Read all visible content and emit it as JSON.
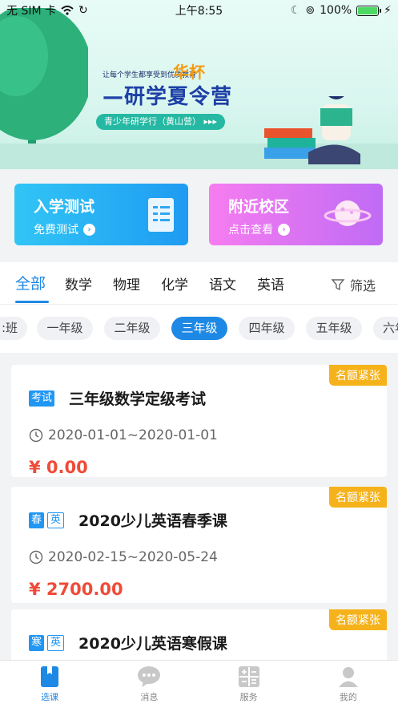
{
  "status_bar": {
    "carrier": "无 SIM 卡",
    "time": "上午8:55",
    "battery": "100%",
    "battery_level": 1.0
  },
  "banner": {
    "slogan": "让每个学生都享受到优质教育",
    "brand": "华杯",
    "title": "—研学夏令营",
    "subtitle": "青少年研学行（黄山营）",
    "arrows": "▸▸▸"
  },
  "quick_cards": {
    "test": {
      "title": "入学测试",
      "subtitle": "免费测试"
    },
    "campus": {
      "title": "附近校区",
      "subtitle": "点击查看"
    }
  },
  "subject_tabs": [
    "全部",
    "数学",
    "物理",
    "化学",
    "语文",
    "英语"
  ],
  "filter_label": "筛选",
  "grades": [
    ":班",
    "一年级",
    "二年级",
    "三年级",
    "四年级",
    "五年级",
    "六年"
  ],
  "active_grade": "三年级",
  "courses": [
    {
      "badge": "名额紧张",
      "tags": [
        {
          "text": "考试",
          "style": "solid"
        }
      ],
      "name": "三年级数学定级考试",
      "date": "2020-01-01~2020-01-01",
      "price": "¥ 0.00"
    },
    {
      "badge": "名额紧张",
      "tags": [
        {
          "text": "春",
          "style": "solid"
        },
        {
          "text": "英",
          "style": "outline"
        }
      ],
      "name": "2020少儿英语春季课",
      "date": "2020-02-15~2020-05-24",
      "price": "¥ 2700.00"
    },
    {
      "badge": "名额紧张",
      "tags": [
        {
          "text": "寒",
          "style": "solid"
        },
        {
          "text": "英",
          "style": "outline"
        }
      ],
      "name": "2020少儿英语寒假课",
      "date": "",
      "price": ""
    }
  ],
  "tabbar": [
    {
      "label": "选课",
      "icon": "bookmark-icon",
      "active": true
    },
    {
      "label": "消息",
      "icon": "chat-bubble-icon",
      "active": false
    },
    {
      "label": "服务",
      "icon": "calculator-icon",
      "active": false
    },
    {
      "label": "我的",
      "icon": "person-icon",
      "active": false
    }
  ],
  "colors": {
    "accent": "#1e88e5",
    "price": "#ef4b38",
    "badge": "#f5b21b"
  }
}
